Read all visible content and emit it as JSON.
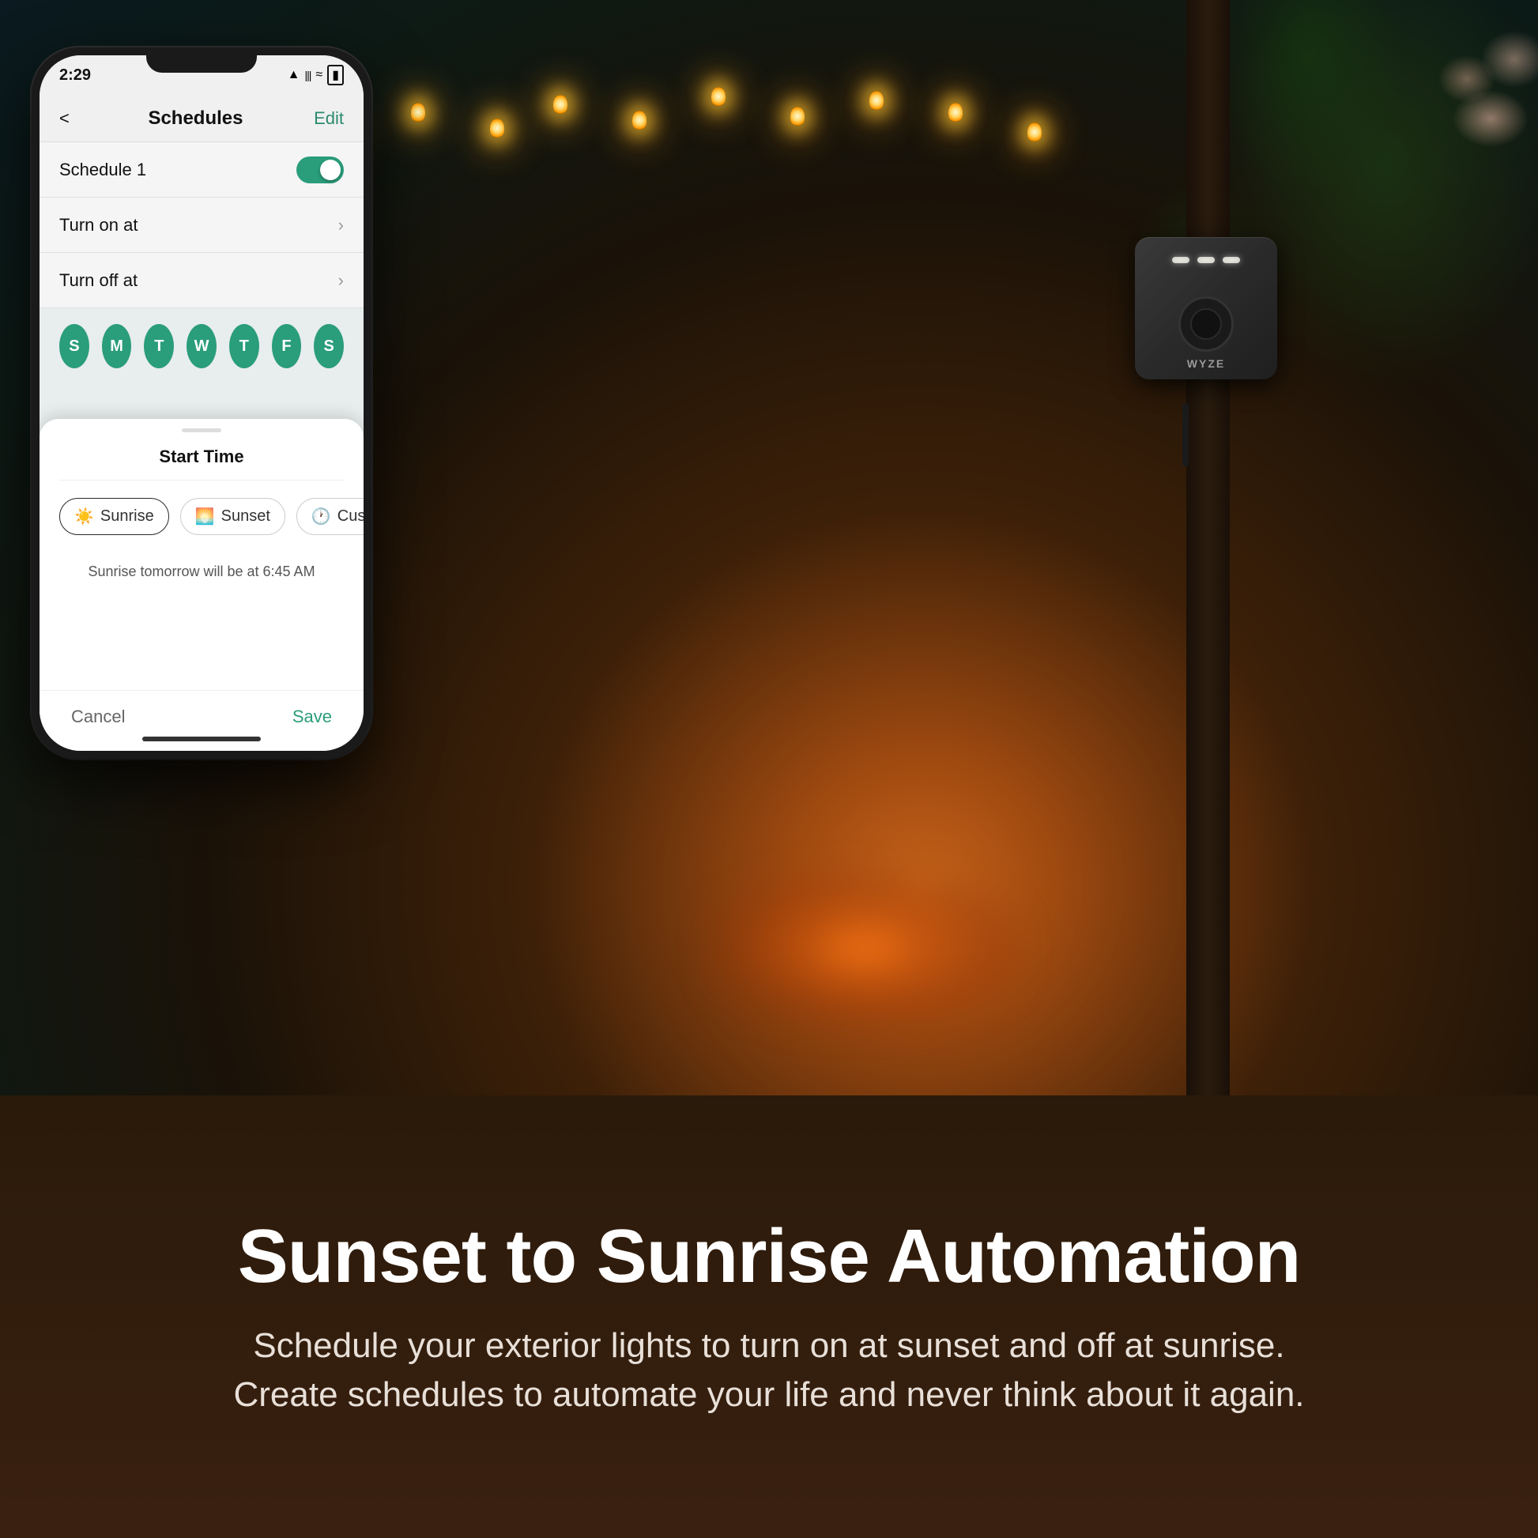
{
  "scene": {
    "background_description": "Outdoor evening backyard with string lights, fire pit, and dark pole"
  },
  "phone": {
    "status_bar": {
      "time": "2:29",
      "location_icon": "▲",
      "signal": "|||",
      "wifi": "WiFi",
      "battery": "Battery"
    },
    "nav": {
      "back_label": "<",
      "title": "Schedules",
      "edit_label": "Edit"
    },
    "schedule": {
      "name": "Schedule 1",
      "toggle_on": true
    },
    "turn_on_row": {
      "label": "Turn on at"
    },
    "turn_off_row": {
      "label": "Turn off at"
    },
    "days": [
      "S",
      "M",
      "T",
      "W",
      "T",
      "F",
      "S"
    ],
    "bottom_sheet": {
      "title": "Start Time",
      "options": [
        {
          "label": "Sunrise",
          "icon": "☀",
          "active": true
        },
        {
          "label": "Sunset",
          "icon": "🌅",
          "active": false
        },
        {
          "label": "Custom",
          "icon": "🕐",
          "active": false
        }
      ],
      "info_text": "Sunrise tomorrow will be at 6:45 AM",
      "cancel_label": "Cancel",
      "save_label": "Save"
    }
  },
  "bottom_section": {
    "headline": "Sunset to Sunrise Automation",
    "subtext_line1": "Schedule your exterior lights to turn on at sunset and off at sunrise.",
    "subtext_line2": "Create schedules to automate your life and never think about it again."
  },
  "wyze_device": {
    "brand": "WYZE"
  }
}
